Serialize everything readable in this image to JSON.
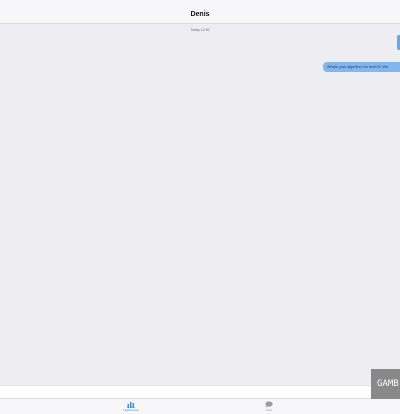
{
  "header": {
    "title": "Denis"
  },
  "conversation": {
    "timestamp": "Today 12:50",
    "messages": [
      {
        "text": "What's your algorithm for level 6? Wh"
      }
    ]
  },
  "tabbar": {
    "tabs": [
      {
        "label": "Highscores",
        "icon": "bar-chart-icon",
        "selected": true
      },
      {
        "label": "Chat",
        "icon": "chat-bubble-icon",
        "selected": false
      }
    ]
  },
  "watermark": {
    "text": "GAMB"
  },
  "colors": {
    "accent": "#3b8ef0",
    "bubble": "#82b6ee",
    "background": "#eeeef2"
  }
}
